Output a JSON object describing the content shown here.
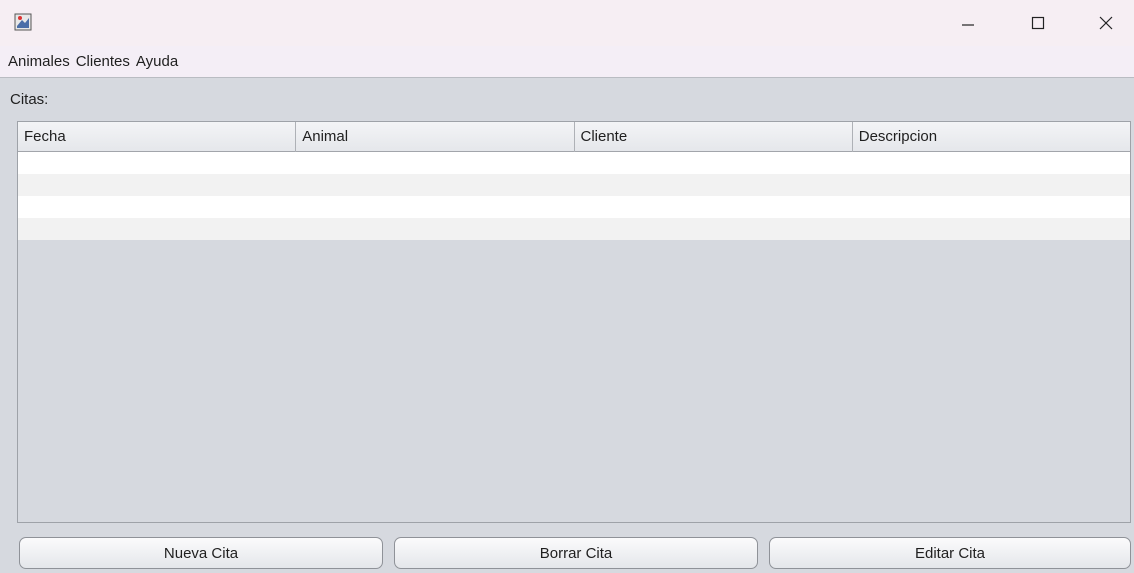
{
  "window": {
    "icon": "java-app-icon",
    "controls": {
      "minimize": "minimize-icon",
      "maximize": "maximize-icon",
      "close": "close-icon"
    }
  },
  "menubar": {
    "items": [
      {
        "label": "Animales"
      },
      {
        "label": "Clientes"
      },
      {
        "label": "Ayuda"
      }
    ]
  },
  "citas": {
    "label": "Citas:",
    "columns": [
      "Fecha",
      "Animal",
      "Cliente",
      "Descripcion"
    ],
    "rows": [
      [
        "",
        "",
        "",
        ""
      ],
      [
        "",
        "",
        "",
        ""
      ],
      [
        "",
        "",
        "",
        ""
      ],
      [
        "",
        "",
        "",
        ""
      ]
    ]
  },
  "buttons": {
    "nueva": "Nueva Cita",
    "borrar": "Borrar Cita",
    "editar": "Editar Cita"
  }
}
